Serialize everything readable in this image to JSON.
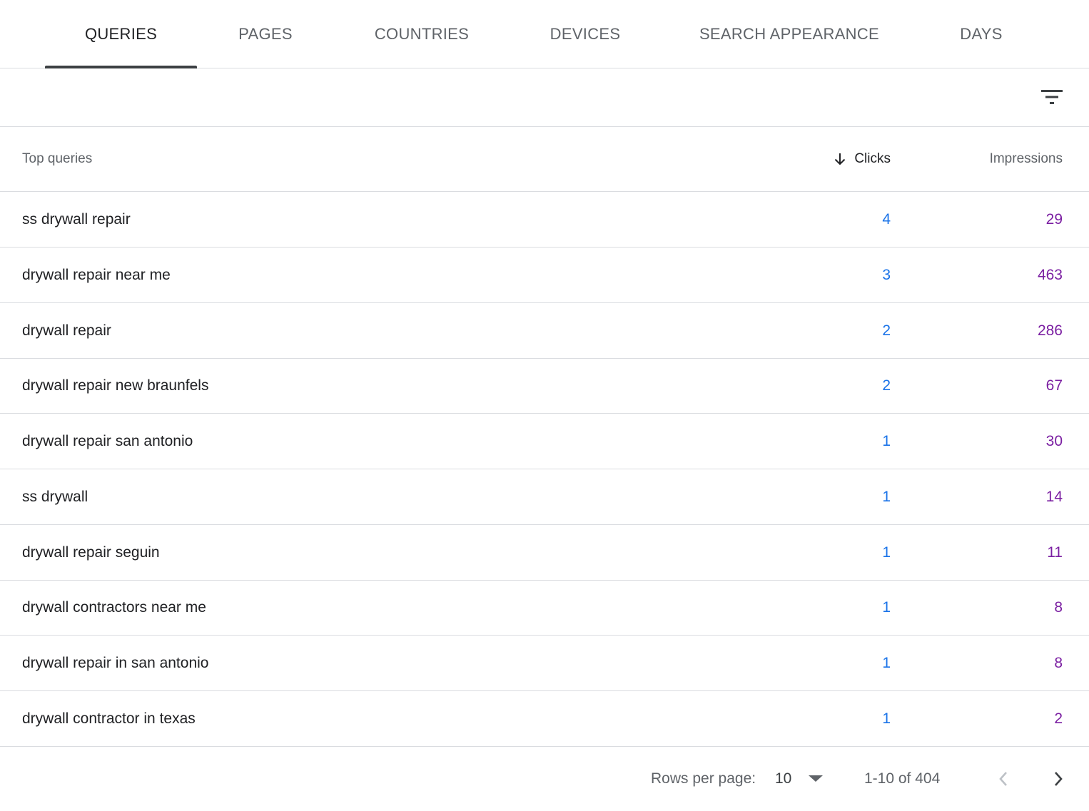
{
  "tabs": [
    {
      "label": "QUERIES",
      "active": true
    },
    {
      "label": "PAGES",
      "active": false
    },
    {
      "label": "COUNTRIES",
      "active": false
    },
    {
      "label": "DEVICES",
      "active": false
    },
    {
      "label": "SEARCH APPEARANCE",
      "active": false
    },
    {
      "label": "DAYS",
      "active": false
    }
  ],
  "toolbar": {
    "filter_icon": "filter-list-icon"
  },
  "table": {
    "columns": {
      "query": "Top queries",
      "clicks": "Clicks",
      "impressions": "Impressions"
    },
    "sort": {
      "column": "clicks",
      "direction": "descending",
      "icon": "arrow-down-icon"
    },
    "rows": [
      {
        "query": "ss drywall repair",
        "clicks": "4",
        "impressions": "29"
      },
      {
        "query": "drywall repair near me",
        "clicks": "3",
        "impressions": "463"
      },
      {
        "query": "drywall repair",
        "clicks": "2",
        "impressions": "286"
      },
      {
        "query": "drywall repair new braunfels",
        "clicks": "2",
        "impressions": "67"
      },
      {
        "query": "drywall repair san antonio",
        "clicks": "1",
        "impressions": "30"
      },
      {
        "query": "ss drywall",
        "clicks": "1",
        "impressions": "14"
      },
      {
        "query": "drywall repair seguin",
        "clicks": "1",
        "impressions": "11"
      },
      {
        "query": "drywall contractors near me",
        "clicks": "1",
        "impressions": "8"
      },
      {
        "query": "drywall repair in san antonio",
        "clicks": "1",
        "impressions": "8"
      },
      {
        "query": "drywall contractor in texas",
        "clicks": "1",
        "impressions": "2"
      }
    ]
  },
  "pagination": {
    "rows_per_page_label": "Rows per page:",
    "rows_per_page_value": "10",
    "range_text": "1-10 of 404",
    "prev_icon": "chevron-left-icon",
    "next_icon": "chevron-right-icon"
  },
  "colors": {
    "clicks": "#1a73e8",
    "impressions": "#7b1fa2",
    "active_tab_indicator": "#3c4043",
    "divider": "#dadce0"
  }
}
